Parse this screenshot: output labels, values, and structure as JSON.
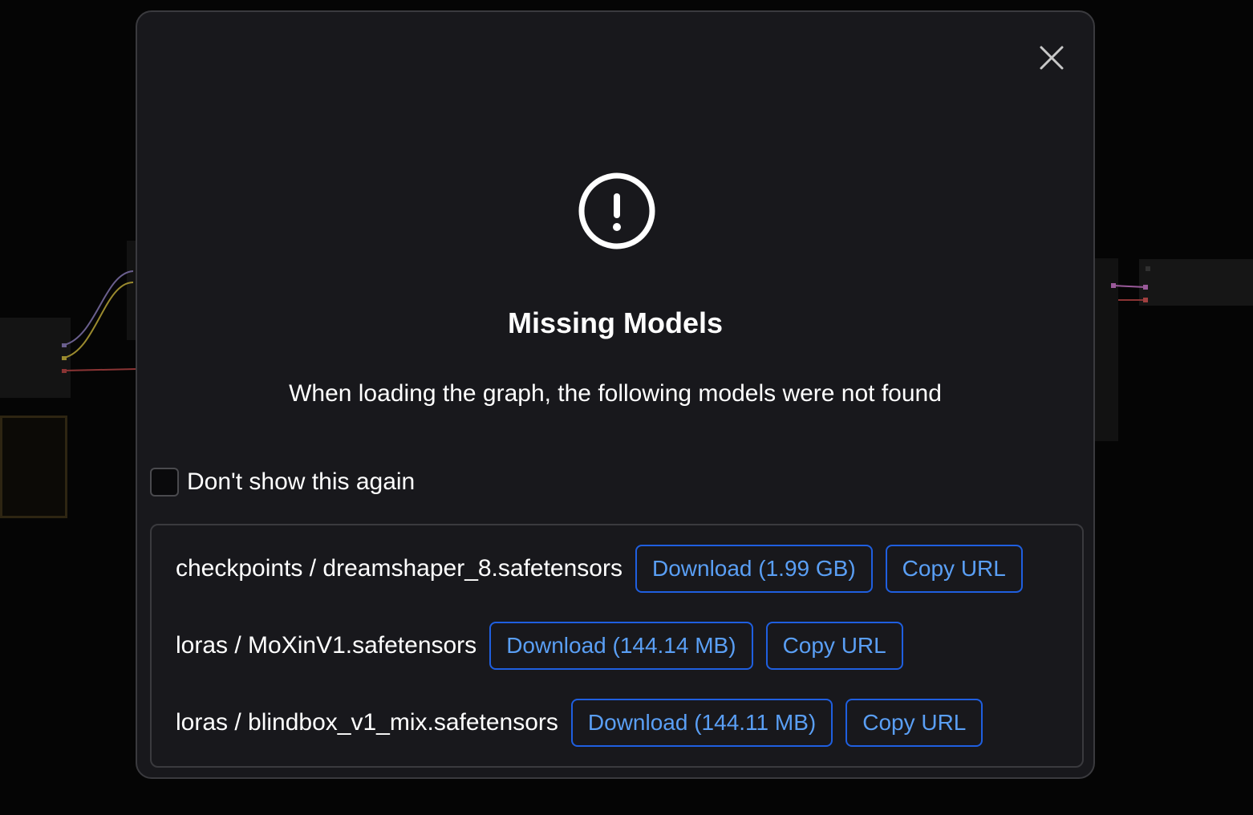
{
  "dialog": {
    "title": "Missing Models",
    "message": "When loading the graph, the following models were not found",
    "dont_show_label": "Don't show this again",
    "dont_show_checked": false
  },
  "models": [
    {
      "name": "checkpoints / dreamshaper_8.safetensors",
      "download_label": "Download (1.99 GB)",
      "copy_label": "Copy URL"
    },
    {
      "name": "loras / MoXinV1.safetensors",
      "download_label": "Download (144.14 MB)",
      "copy_label": "Copy URL"
    },
    {
      "name": "loras / blindbox_v1_mix.safetensors",
      "download_label": "Download (144.11 MB)",
      "copy_label": "Copy URL"
    }
  ],
  "colors": {
    "background": "#050505",
    "dialog_bg": "#18181c",
    "border": "#3a3a3e",
    "accent_border": "#1f5fe0",
    "accent_text": "#5a9ff5",
    "text": "#ffffff"
  },
  "icons": {
    "close": "close-icon",
    "warning": "exclamation-circle-icon"
  }
}
